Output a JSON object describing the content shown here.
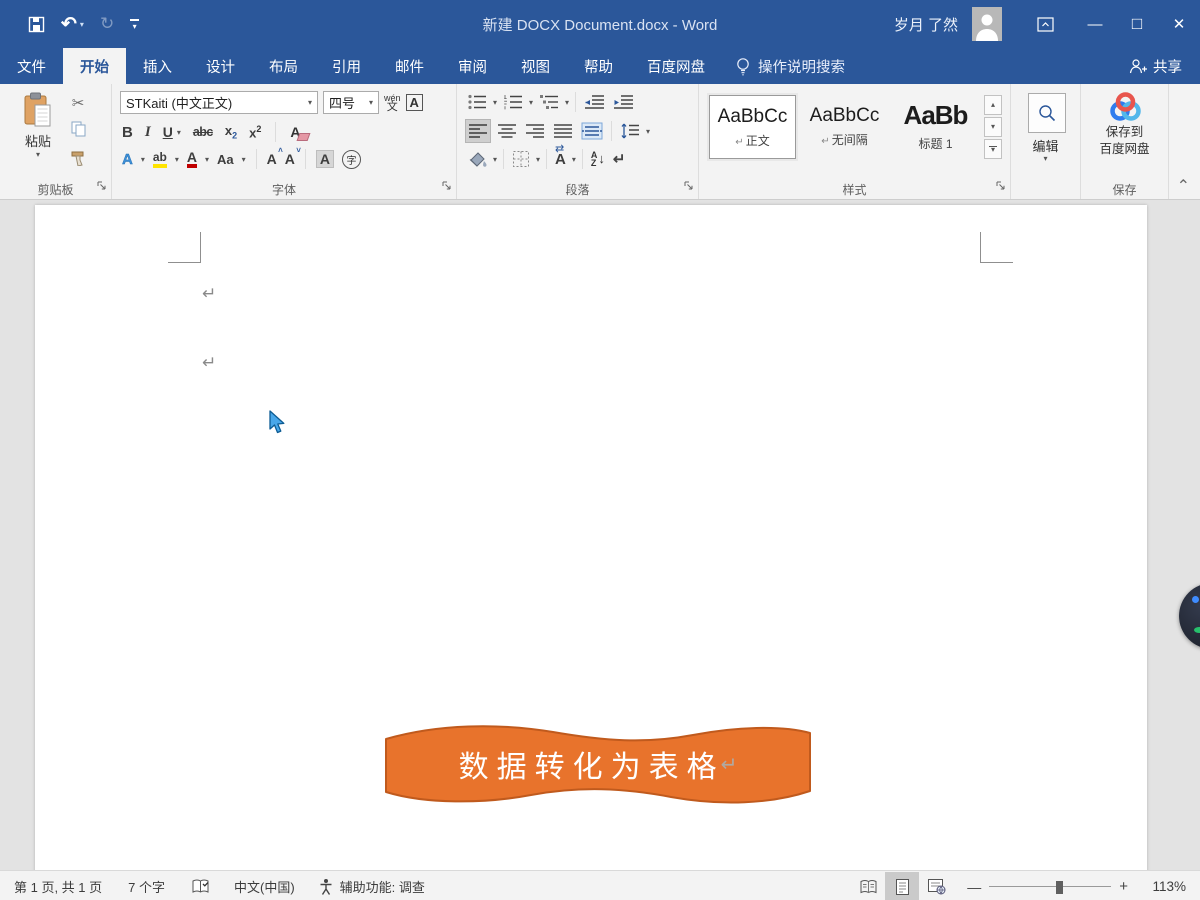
{
  "colors": {
    "titlebar": "#2b579a",
    "banner_fill": "#e8732c",
    "banner_border": "#c05a1d",
    "highlight_yellow": "#ffe400",
    "font_color_red": "#c00000"
  },
  "titlebar": {
    "title": "新建 DOCX Document.docx - Word",
    "user_name": "岁月 了然"
  },
  "glyphs": {
    "caret": "▾",
    "caret_up": "▴",
    "undo": "↶",
    "redo": "↻",
    "cut": "✂",
    "minimize": "—",
    "maximize": "□",
    "close": "✕",
    "collapse_ribbon": "⌃",
    "zoom_minus": "—",
    "zoom_plus": "+"
  },
  "tabs": {
    "file": "文件",
    "items": [
      {
        "label": "开始"
      },
      {
        "label": "插入"
      },
      {
        "label": "设计"
      },
      {
        "label": "布局"
      },
      {
        "label": "引用"
      },
      {
        "label": "邮件"
      },
      {
        "label": "审阅"
      },
      {
        "label": "视图"
      },
      {
        "label": "帮助"
      },
      {
        "label": "百度网盘"
      }
    ],
    "tell_me": "操作说明搜索",
    "share": "共享"
  },
  "ribbon": {
    "clipboard": {
      "paste_label": "粘贴",
      "group_label": "剪贴板"
    },
    "font": {
      "name_value": "STKaiti (中文正文)",
      "size_value": "四号",
      "phonetic_top": "wén",
      "phonetic_bottom": "文",
      "char_border_glyph": "A",
      "bold_glyph": "B",
      "italic_glyph": "I",
      "underline_glyph": "U",
      "strike_glyph": "abc",
      "sub_base": "x",
      "sub_small": "2",
      "sup_base": "x",
      "sup_small": "2",
      "clear_glyph": "A",
      "effects_glyph": "A",
      "highlight_glyph": "ab",
      "color_glyph": "A",
      "case_glyph": "Aa",
      "grow_glyph": "A",
      "grow_mark": "˄",
      "shrink_glyph": "A",
      "shrink_mark": "˅",
      "shading_glyph": "A",
      "enclose_glyph": "字",
      "group_label": "字体"
    },
    "paragraph": {
      "sort_top": "A",
      "sort_bottom": "Z",
      "sort_arrow": "↓",
      "mark_glyph": "↵",
      "asian_glyph": "A",
      "asian_arrows": "⇄",
      "group_label": "段落"
    },
    "styles": {
      "cards": [
        {
          "preview": "AaBbCc",
          "mark": "↵",
          "name": "正文"
        },
        {
          "preview": "AaBbCc",
          "mark": "↵",
          "name": "无间隔"
        },
        {
          "preview": "AaBb",
          "mark": "",
          "name": "标题 1"
        }
      ],
      "group_label": "样式"
    },
    "editing": {
      "label": "编辑"
    },
    "save": {
      "line1": "保存到",
      "line2": "百度网盘",
      "group_label": "保存"
    }
  },
  "document": {
    "banner_text": "数据转化为表格",
    "paragraph_mark": "↵"
  },
  "statusbar": {
    "page_info": "第 1 页, 共 1 页",
    "word_count": "7 个字",
    "language": "中文(中国)",
    "accessibility": "辅助功能: 调查",
    "zoom_value": "113%"
  }
}
